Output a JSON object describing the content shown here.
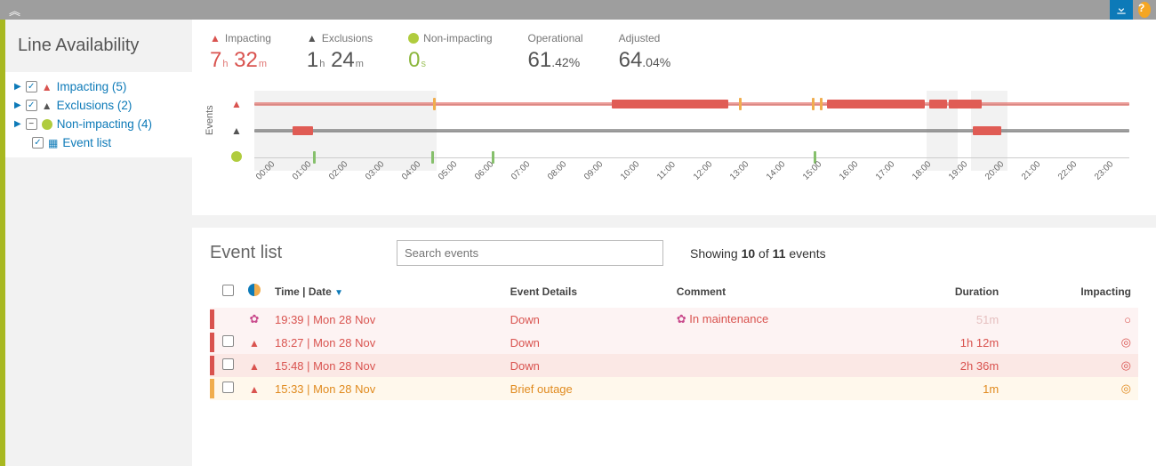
{
  "topbar": {
    "download_title": "Download",
    "help_title": "Help"
  },
  "sidebar": {
    "title": "Line Availability",
    "tree": {
      "impacting": {
        "label": "Impacting (5)"
      },
      "exclusions": {
        "label": "Exclusions (2)"
      },
      "nonimpacting": {
        "label": "Non-impacting (4)"
      },
      "eventlist": {
        "label": "Event list"
      }
    }
  },
  "stats": {
    "impacting": {
      "label": "Impacting",
      "h": "7",
      "m": "32"
    },
    "exclusions": {
      "label": "Exclusions",
      "h": "1",
      "m": "24"
    },
    "nonimpacting": {
      "label": "Non-impacting",
      "v": "0",
      "unit": "s"
    },
    "operational": {
      "label": "Operational",
      "int": "61",
      "frac": ".42",
      "unit": "%"
    },
    "adjusted": {
      "label": "Adjusted",
      "int": "64",
      "frac": ".04",
      "unit": "%"
    }
  },
  "timeline": {
    "ylabel": "Events",
    "ticks": [
      "00:00",
      "01:00",
      "02:00",
      "03:00",
      "04:00",
      "05:00",
      "06:00",
      "07:00",
      "08:00",
      "09:00",
      "10:00",
      "11:00",
      "12:00",
      "13:00",
      "14:00",
      "15:00",
      "16:00",
      "17:00",
      "18:00",
      "19:00",
      "20:00",
      "21:00",
      "22:00",
      "23:00"
    ]
  },
  "events": {
    "title": "Event list",
    "search_placeholder": "Search events",
    "showing": {
      "prefix": "Showing ",
      "n": "10",
      "mid": " of ",
      "total": "11",
      "suffix": " events"
    },
    "columns": {
      "time": "Time | Date",
      "details": "Event Details",
      "comment": "Comment",
      "duration": "Duration",
      "impacting": "Impacting"
    },
    "rows": [
      {
        "kind": "maint",
        "time": "19:39 | Mon 28 Nov",
        "details": "Down",
        "comment": "In maintenance",
        "duration": "51m",
        "faded": true
      },
      {
        "kind": "impact",
        "time": "18:27 | Mon 28 Nov",
        "details": "Down",
        "comment": "",
        "duration": "1h 12m",
        "faded": false
      },
      {
        "kind": "impact",
        "time": "15:48 | Mon 28 Nov",
        "details": "Down",
        "comment": "",
        "duration": "2h 36m",
        "faded": false,
        "alt": true
      },
      {
        "kind": "brief",
        "time": "15:33 | Mon 28 Nov",
        "details": "Brief outage",
        "comment": "",
        "duration": "1m",
        "faded": false
      }
    ]
  },
  "chart_data": {
    "type": "timeline",
    "x_unit": "hour_of_day",
    "x_range": [
      0,
      24
    ],
    "shaded_regions": [
      {
        "start": 0,
        "end": 5
      },
      {
        "start": 18.45,
        "end": 19.3
      },
      {
        "start": 19.65,
        "end": 20.65
      }
    ],
    "series": [
      {
        "name": "Impacting",
        "color": "#e05c55",
        "baseline": true,
        "segments": [
          {
            "start": 4.9,
            "end": 5.0,
            "style": "tick",
            "color": "#f0ad4e"
          },
          {
            "start": 9.8,
            "end": 13.0
          },
          {
            "start": 13.3,
            "end": 13.35,
            "style": "tick",
            "color": "#f0ad4e"
          },
          {
            "start": 15.3,
            "end": 15.4,
            "style": "tick",
            "color": "#f0ad4e"
          },
          {
            "start": 15.5,
            "end": 15.55,
            "style": "tick",
            "color": "#f0ad4e"
          },
          {
            "start": 15.7,
            "end": 18.4
          },
          {
            "start": 18.5,
            "end": 19.0
          },
          {
            "start": 19.05,
            "end": 19.95
          }
        ]
      },
      {
        "name": "Exclusions",
        "color": "#666",
        "baseline": true,
        "segments": [
          {
            "start": 1.05,
            "end": 1.6,
            "color": "#e05c55"
          },
          {
            "start": 19.7,
            "end": 20.5,
            "color": "#e05c55"
          }
        ]
      },
      {
        "name": "Non-impacting",
        "color": "#86c06c",
        "baseline": false,
        "segments": [
          {
            "start": 1.6,
            "end": 1.65,
            "style": "tick"
          },
          {
            "start": 4.85,
            "end": 4.9,
            "style": "tick"
          },
          {
            "start": 6.5,
            "end": 6.55,
            "style": "tick"
          },
          {
            "start": 15.35,
            "end": 15.4,
            "style": "tick"
          }
        ]
      }
    ]
  }
}
